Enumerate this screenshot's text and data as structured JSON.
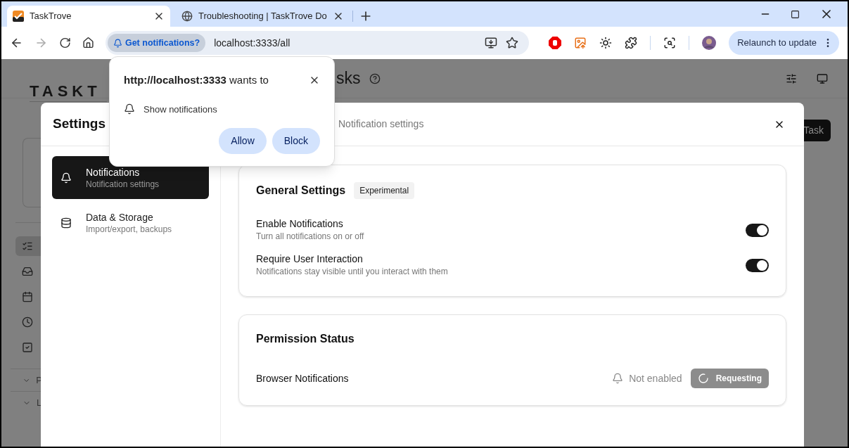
{
  "browser": {
    "tabs": [
      {
        "title": "TaskTrove",
        "kind": "app",
        "selected": true
      },
      {
        "title": "Troubleshooting | TaskTrove Do",
        "kind": "web",
        "selected": false
      }
    ],
    "chip": "Get notifications?",
    "url": "localhost:3333/all",
    "relaunch": "Relaunch to update"
  },
  "app": {
    "logo": "TASKT",
    "heading": "sks",
    "add_button": "Task",
    "nav": [
      {
        "selected": true
      },
      {
        "selected": false
      },
      {
        "selected": false
      },
      {
        "selected": false
      },
      {
        "selected": false
      }
    ],
    "sections": [
      "P",
      "L"
    ]
  },
  "settings": {
    "title": "Settings",
    "subtitle": "Notification settings",
    "nav": [
      {
        "title": "Notifications",
        "subtitle": "Notification settings",
        "selected": true
      },
      {
        "title": "Data & Storage",
        "subtitle": "Import/export, backups",
        "selected": false
      }
    ],
    "general": {
      "title": "General Settings",
      "badge": "Experimental",
      "toggles": [
        {
          "label": "Enable Notifications",
          "description": "Turn all notifications on or off",
          "on": true
        },
        {
          "label": "Require User Interaction",
          "description": "Notifications stay visible until you interact with them",
          "on": true
        }
      ]
    },
    "permission": {
      "title": "Permission Status",
      "label": "Browser Notifications",
      "status": "Not enabled",
      "button": "Requesting",
      "loading": true
    }
  },
  "prompt": {
    "title": "**http://localhost:3333** wants to",
    "permission": "Show notifications",
    "buttons": [
      "Allow",
      "Block"
    ]
  }
}
